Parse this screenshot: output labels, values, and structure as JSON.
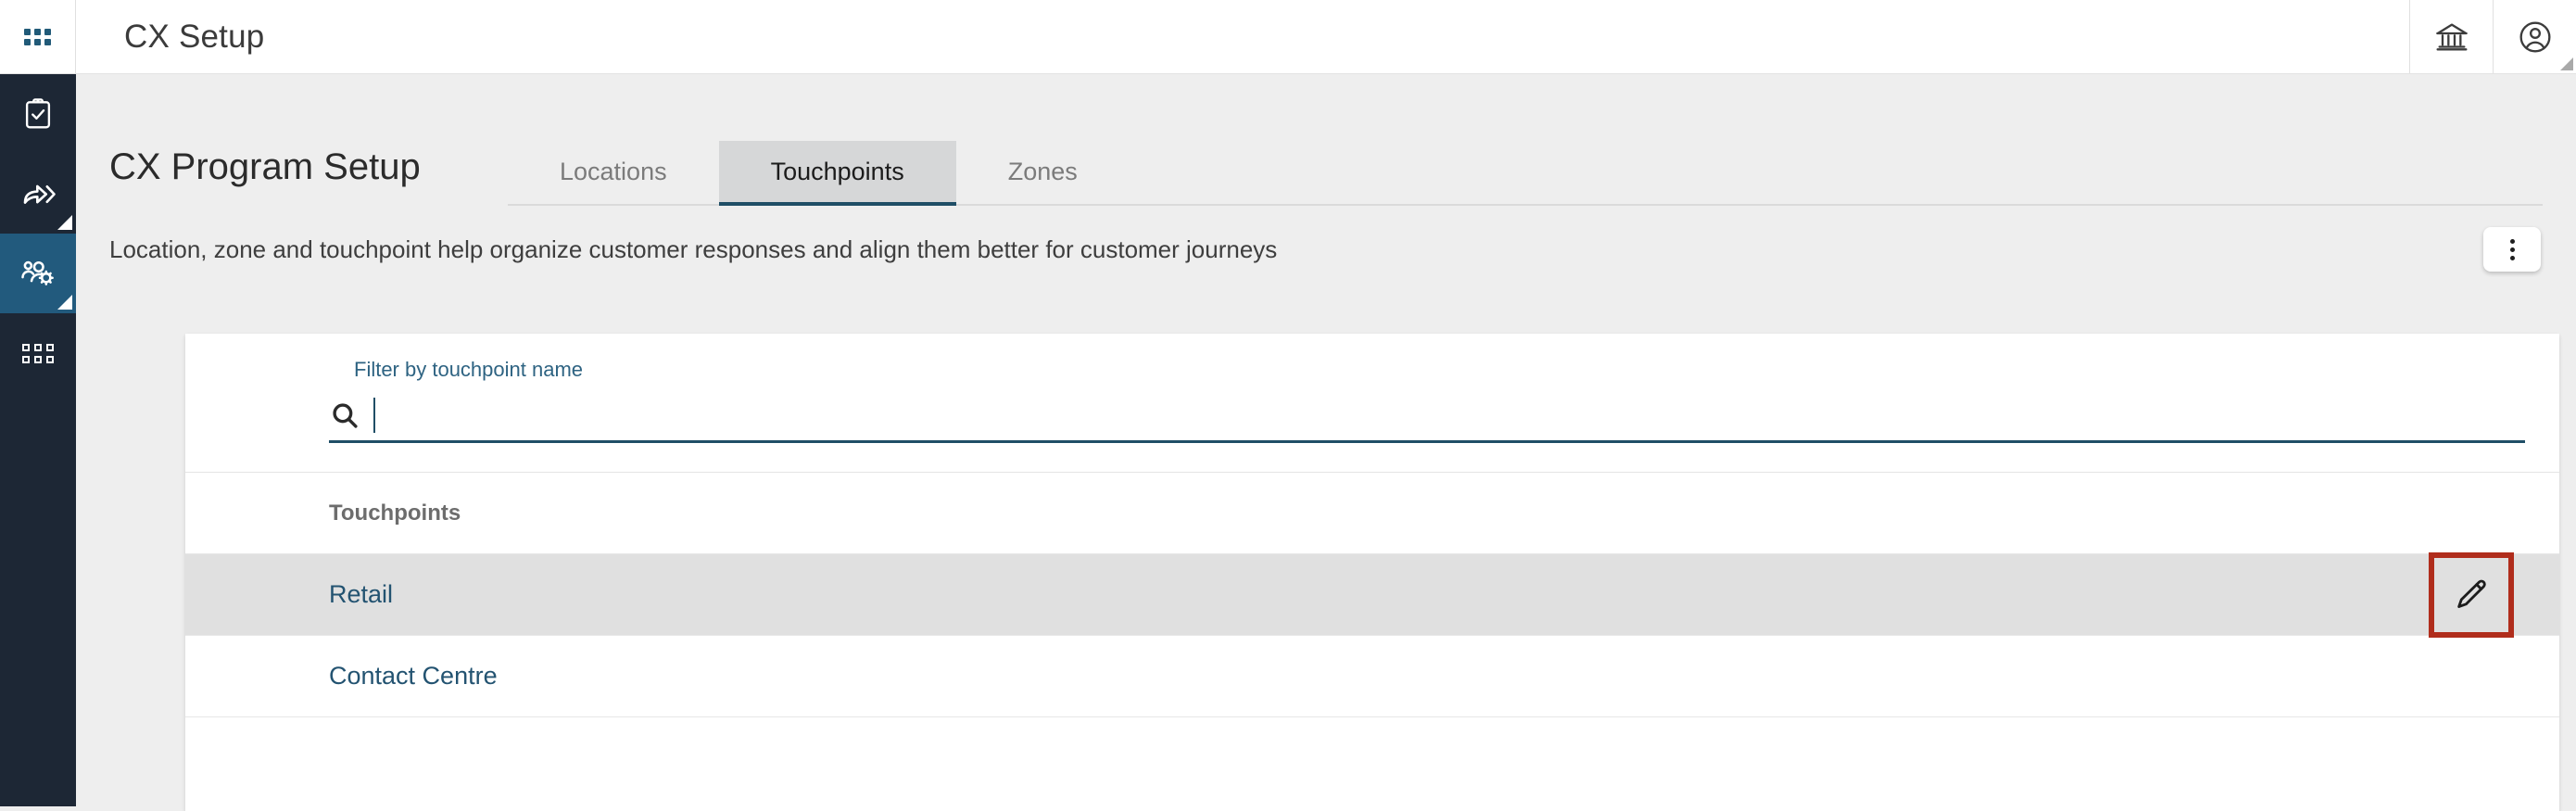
{
  "topbar": {
    "app_title": "CX Setup",
    "waffle_icon": "apps-grid-icon",
    "org_icon": "bank-institution-icon",
    "account_icon": "user-account-icon"
  },
  "sidebar": {
    "items": [
      {
        "label": "Surveys",
        "icon": "clipboard-check-icon",
        "active": false,
        "corner": false
      },
      {
        "label": "Distribute",
        "icon": "share-arrow-icon",
        "active": false,
        "corner": true
      },
      {
        "label": "CX Setup",
        "icon": "people-gear-icon",
        "active": true,
        "corner": true
      },
      {
        "label": "Dashboards",
        "icon": "grid-apps-icon",
        "active": false,
        "corner": false
      }
    ]
  },
  "page": {
    "title": "CX Program Setup",
    "subtitle": "Location, zone and touchpoint help organize customer responses and align them better for customer journeys",
    "kebab_label": "More options"
  },
  "tabs": [
    {
      "label": "Locations",
      "active": false
    },
    {
      "label": "Touchpoints",
      "active": true
    },
    {
      "label": "Zones",
      "active": false
    }
  ],
  "filter": {
    "label": "Filter by touchpoint name",
    "value": "",
    "placeholder": "",
    "icon": "search-icon"
  },
  "list": {
    "header": "Touchpoints",
    "rows": [
      {
        "name": "Retail",
        "selected": true,
        "edit_icon": "pencil-edit-icon",
        "edit_highlighted": true
      },
      {
        "name": "Contact Centre",
        "selected": false,
        "edit_icon": "pencil-edit-icon",
        "edit_highlighted": false
      }
    ]
  },
  "colors": {
    "accent": "#1f4e66",
    "rail_bg": "#1d2735",
    "rail_active": "#225a7d",
    "link": "#235371",
    "highlight_box": "#b02d1c",
    "page_bg": "#eeeeee"
  }
}
